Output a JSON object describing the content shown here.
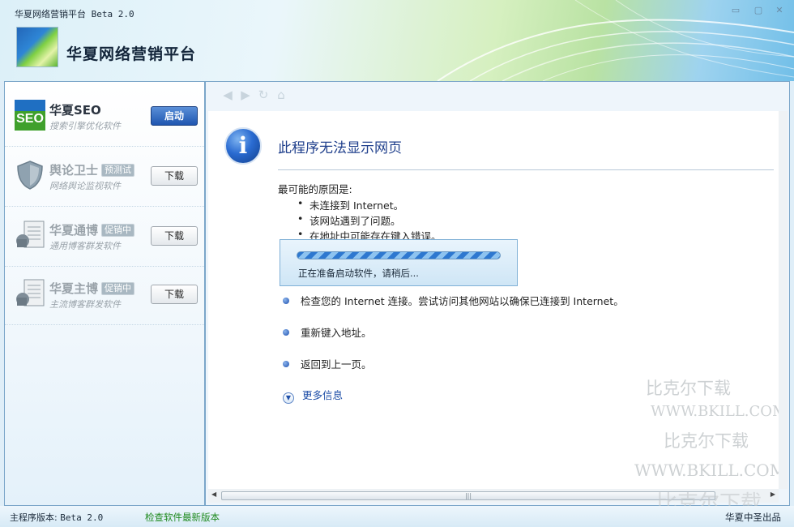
{
  "window": {
    "title": "华夏网络营销平台 Beta 2.0",
    "minimize": "▭",
    "maximize": "▢",
    "close": "✕"
  },
  "header": {
    "app_title": "华夏网络营销平台"
  },
  "sidebar": {
    "items": [
      {
        "name": "华夏SEO",
        "badge": "",
        "desc": "搜索引擎优化软件",
        "button": "启动",
        "icon": "seo-logo-icon"
      },
      {
        "name": "舆论卫士",
        "badge": "预测试",
        "desc": "网络舆论监视软件",
        "button": "下载",
        "icon": "shield-icon"
      },
      {
        "name": "华夏通博",
        "badge": "促销中",
        "desc": "通用博客群发软件",
        "button": "下载",
        "icon": "blog-tool-icon"
      },
      {
        "name": "华夏主博",
        "badge": "促销中",
        "desc": "主流博客群发软件",
        "button": "下载",
        "icon": "blog-tool-icon"
      }
    ]
  },
  "browser": {
    "nav_icons": [
      "back-arrow-icon",
      "forward-arrow-icon",
      "refresh-icon",
      "home-icon"
    ],
    "error_title": "此程序无法显示网页",
    "reason_heading": "最可能的原因是:",
    "reasons": [
      "未连接到 Internet。",
      "该网站遇到了问题。",
      "在地址中可能存在键入错误。"
    ],
    "actions": [
      "检查您的 Internet 连接。尝试访问其他网站以确保已连接到 Internet。",
      "重新键入地址。",
      "返回到上一页。"
    ],
    "more_info": "更多信息",
    "loading_text": "正在准备启动软件，请稍后..."
  },
  "watermark": [
    "比克尔下载",
    "WWW.BKILL.COM",
    "比克尔下载",
    "WWW.BKILL.COM",
    "比克尔下载"
  ],
  "status": {
    "version_label": "主程序版本:",
    "version_value": "Beta 2.0",
    "check_update": "检查软件最新版本",
    "credit": "华夏中圣出品"
  }
}
